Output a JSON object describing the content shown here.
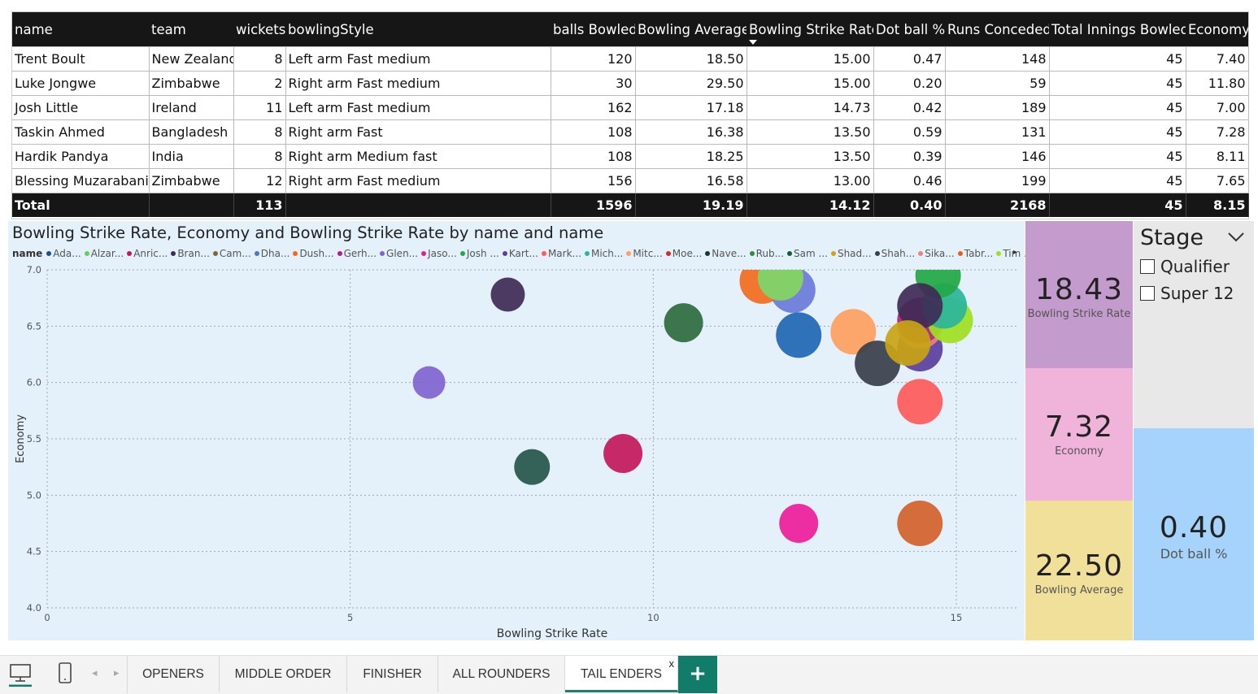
{
  "table": {
    "columns": [
      "name",
      "team",
      "wickets",
      "bowlingStyle",
      "balls Bowled",
      "Bowling Average",
      "Bowling Strike Rate",
      "Dot ball %",
      "Runs Conceded",
      "Total Innings Bowled",
      "Economy"
    ],
    "rows": [
      [
        "Trent Boult",
        "New Zealand",
        "8",
        "Left arm Fast medium",
        "120",
        "18.50",
        "15.00",
        "0.47",
        "148",
        "45",
        "7.40"
      ],
      [
        "Luke Jongwe",
        "Zimbabwe",
        "2",
        "Right arm Fast medium",
        "30",
        "29.50",
        "15.00",
        "0.20",
        "59",
        "45",
        "11.80"
      ],
      [
        "Josh Little",
        "Ireland",
        "11",
        "Left arm Fast medium",
        "162",
        "17.18",
        "14.73",
        "0.42",
        "189",
        "45",
        "7.00"
      ],
      [
        "Taskin Ahmed",
        "Bangladesh",
        "8",
        "Right arm Fast",
        "108",
        "16.38",
        "13.50",
        "0.59",
        "131",
        "45",
        "7.28"
      ],
      [
        "Hardik Pandya",
        "India",
        "8",
        "Right arm Medium fast",
        "108",
        "18.25",
        "13.50",
        "0.39",
        "146",
        "45",
        "8.11"
      ],
      [
        "Blessing Muzarabani",
        "Zimbabwe",
        "12",
        "Right arm Fast medium",
        "156",
        "16.58",
        "13.00",
        "0.46",
        "199",
        "45",
        "7.65"
      ]
    ],
    "total": [
      "Total",
      "",
      "113",
      "",
      "1596",
      "19.19",
      "14.12",
      "0.40",
      "2168",
      "45",
      "8.15"
    ]
  },
  "chart": {
    "title": "Bowling Strike Rate, Economy and Bowling Strike Rate by name and name",
    "legend_label": "name",
    "legend_next": "▸"
  },
  "chart_data": {
    "type": "scatter",
    "title": "Bowling Strike Rate, Economy and Bowling Strike Rate by name and name",
    "xlabel": "Bowling Strike Rate",
    "ylabel": "Economy",
    "xlim": [
      0,
      16
    ],
    "ylim": [
      4.0,
      7.0
    ],
    "xticks": [
      "0",
      "5",
      "10",
      "15"
    ],
    "yticks": [
      "4.0",
      "4.5",
      "5.0",
      "5.5",
      "6.0",
      "6.5",
      "7.0"
    ],
    "grid": true,
    "legend_placement": "top",
    "legend": [
      {
        "name": "Ada...",
        "color": "#1f4e8c"
      },
      {
        "name": "Alzar...",
        "color": "#5fd35f"
      },
      {
        "name": "Anric...",
        "color": "#c2185b"
      },
      {
        "name": "Bran...",
        "color": "#3f2a56"
      },
      {
        "name": "Cam...",
        "color": "#7a6a2e"
      },
      {
        "name": "Dha...",
        "color": "#4a78c8"
      },
      {
        "name": "Dush...",
        "color": "#f26b1d"
      },
      {
        "name": "Gerh...",
        "color": "#b21c8e"
      },
      {
        "name": "Glen...",
        "color": "#8064d0"
      },
      {
        "name": "Jaso...",
        "color": "#e0218a"
      },
      {
        "name": "Josh ...",
        "color": "#22a845"
      },
      {
        "name": "Kart...",
        "color": "#5a3f9e"
      },
      {
        "name": "Mark...",
        "color": "#ff5a5a"
      },
      {
        "name": "Mich...",
        "color": "#2bb59b"
      },
      {
        "name": "Mitc...",
        "color": "#ffa060"
      },
      {
        "name": "Moe...",
        "color": "#d62828"
      },
      {
        "name": "Nave...",
        "color": "#163a2a"
      },
      {
        "name": "Rub...",
        "color": "#2e8b3e"
      },
      {
        "name": "Sam ...",
        "color": "#1a5a34"
      },
      {
        "name": "Shad...",
        "color": "#d4a017"
      },
      {
        "name": "Shah...",
        "color": "#3a3f4a"
      },
      {
        "name": "Sika...",
        "color": "#f08080"
      },
      {
        "name": "Tabr...",
        "color": "#e06020"
      },
      {
        "name": "Tim ...",
        "color": "#a0e020"
      }
    ],
    "points": [
      {
        "x": 7.6,
        "y": 6.78,
        "color": "#3f2a56"
      },
      {
        "x": 10.5,
        "y": 6.53,
        "color": "#2e6b3e"
      },
      {
        "x": 6.3,
        "y": 6.0,
        "color": "#8064d0"
      },
      {
        "x": 8.0,
        "y": 5.25,
        "color": "#25554a"
      },
      {
        "x": 9.5,
        "y": 5.37,
        "color": "#c2185b"
      },
      {
        "x": 12.4,
        "y": 4.75,
        "color": "#ee1c9a"
      },
      {
        "x": 14.4,
        "y": 4.75,
        "color": "#d2622a"
      },
      {
        "x": 14.4,
        "y": 5.83,
        "color": "#ff5a5a"
      },
      {
        "x": 12.3,
        "y": 6.82,
        "color": "#6a7ad8"
      },
      {
        "x": 11.8,
        "y": 6.9,
        "color": "#f26b1d"
      },
      {
        "x": 12.1,
        "y": 6.93,
        "color": "#f7a84a"
      },
      {
        "x": 12.1,
        "y": 6.93,
        "color": "#7ad36a"
      },
      {
        "x": 12.4,
        "y": 6.42,
        "color": "#1f67b4"
      },
      {
        "x": 13.3,
        "y": 6.45,
        "color": "#ffa060"
      },
      {
        "x": 13.7,
        "y": 6.17,
        "color": "#3a3f4a"
      },
      {
        "x": 14.4,
        "y": 6.3,
        "color": "#5a3f9e"
      },
      {
        "x": 14.4,
        "y": 6.5,
        "color": "#f08080"
      },
      {
        "x": 14.4,
        "y": 6.55,
        "color": "#ae2a7e"
      },
      {
        "x": 14.9,
        "y": 6.55,
        "color": "#a0e020"
      },
      {
        "x": 14.8,
        "y": 6.68,
        "color": "#2bb59b"
      },
      {
        "x": 14.7,
        "y": 6.95,
        "color": "#22a845"
      },
      {
        "x": 14.4,
        "y": 6.68,
        "color": "#3f2a56"
      },
      {
        "x": 14.2,
        "y": 6.35,
        "color": "#c8a414"
      }
    ]
  },
  "cards": {
    "bsr": {
      "value": "18.43",
      "caption": "Bowling Strike Rate"
    },
    "eco": {
      "value": "7.32",
      "caption": "Economy"
    },
    "bavg": {
      "value": "22.50",
      "caption": "Bowling Average"
    },
    "dot": {
      "value": "0.40",
      "caption": "Dot ball %"
    }
  },
  "slicer": {
    "title": "Stage",
    "options": [
      "Qualifier",
      "Super 12"
    ]
  },
  "tabs": [
    "OPENERS",
    "MIDDLE ORDER",
    "FINISHER",
    "ALL ROUNDERS",
    "TAIL ENDERS"
  ],
  "active_tab": "TAIL ENDERS",
  "tab_close": "x",
  "add_tab": "+",
  "colors": {
    "accent": "#127c6a",
    "header": "#161616"
  },
  "icons": [
    "desktop-icon",
    "phone-icon",
    "chevron-left-icon",
    "chevron-right-icon",
    "chevron-down-icon"
  ]
}
